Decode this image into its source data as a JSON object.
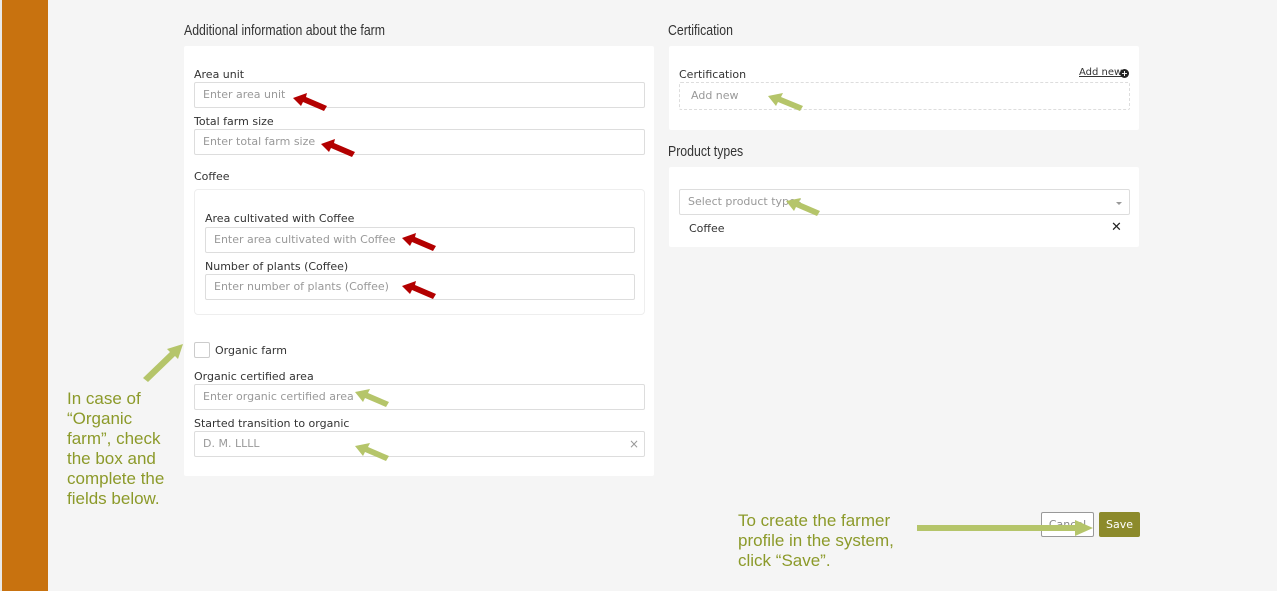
{
  "farm_info": {
    "title": "Additional information about the farm",
    "area_unit": {
      "label": "Area unit",
      "placeholder": "Enter area unit"
    },
    "total_farm_size": {
      "label": "Total farm size",
      "placeholder": "Enter total farm size"
    },
    "crop": {
      "label": "Coffee",
      "area_cultivated": {
        "label": "Area cultivated with Coffee",
        "placeholder": "Enter area cultivated with Coffee"
      },
      "plants": {
        "label": "Number of plants (Coffee)",
        "placeholder": "Enter number of plants (Coffee)"
      }
    },
    "organic_farm": {
      "label": "Organic farm",
      "checked": false
    },
    "organic_area": {
      "label": "Organic certified area",
      "placeholder": "Enter organic certified area"
    },
    "transition": {
      "label": "Started transition to organic",
      "placeholder": "D. M. LLLL",
      "clear_icon": "close-icon"
    }
  },
  "certification": {
    "title": "Certification",
    "label": "Certification",
    "add_new": "Add new",
    "add_icon": "plus-circle-icon",
    "placeholder": "Add new"
  },
  "product_types": {
    "title": "Product types",
    "placeholder": "Select product types",
    "selected": [
      "Coffee"
    ],
    "remove_icon": "close-icon"
  },
  "buttons": {
    "cancel": "Cancel",
    "save": "Save"
  },
  "annotations": {
    "organic_note": [
      "In case of",
      "“Organic",
      "farm”, check",
      "the box and",
      "complete the",
      "fields below."
    ],
    "save_note": [
      "To create the farmer",
      "profile in the system,",
      "click  “Save”."
    ]
  },
  "colors": {
    "sidebar": "#c8720f",
    "save_button": "#8c8a2b",
    "annotation_text": "#8c9a2a",
    "arrow_red": "#b30000",
    "arrow_green": "#b5c56a"
  }
}
